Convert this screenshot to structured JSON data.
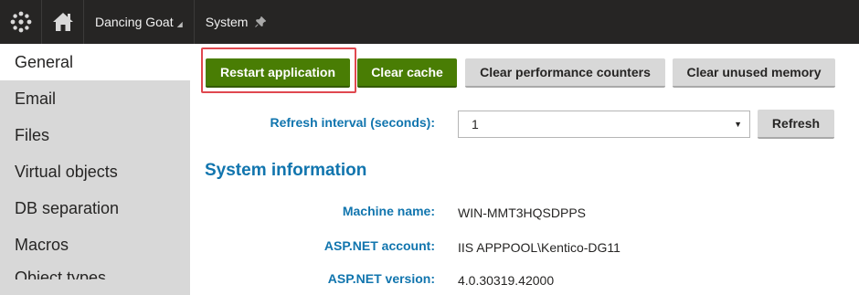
{
  "header": {
    "site_name": "Dancing Goat",
    "app_name": "System",
    "logo_icon": "kentico-logo-icon",
    "home_icon": "home-icon",
    "pin_icon": "pin-icon"
  },
  "sidebar": {
    "items": [
      {
        "label": "General",
        "active": true
      },
      {
        "label": "Email"
      },
      {
        "label": "Files"
      },
      {
        "label": "Virtual objects"
      },
      {
        "label": "DB separation"
      },
      {
        "label": "Macros"
      },
      {
        "label": "Object types"
      }
    ]
  },
  "actions": {
    "restart": "Restart application",
    "clear_cache": "Clear cache",
    "clear_perf": "Clear performance counters",
    "clear_memory": "Clear unused memory"
  },
  "refresh": {
    "label": "Refresh interval (seconds):",
    "value": "1",
    "button": "Refresh"
  },
  "system_info": {
    "title": "System information",
    "rows": [
      {
        "label": "Machine name:",
        "value": "WIN-MMT3HQSDPPS"
      },
      {
        "label": "ASP.NET account:",
        "value": "IIS APPPOOL\\Kentico-DG11"
      },
      {
        "label": "ASP.NET version:",
        "value": "4.0.30319.42000"
      }
    ]
  },
  "colors": {
    "topbar": "#262524",
    "sidebar": "#d8d8d8",
    "primary_green": "#497d04",
    "label_blue": "#1175ae",
    "highlight_red": "#e0484f"
  }
}
